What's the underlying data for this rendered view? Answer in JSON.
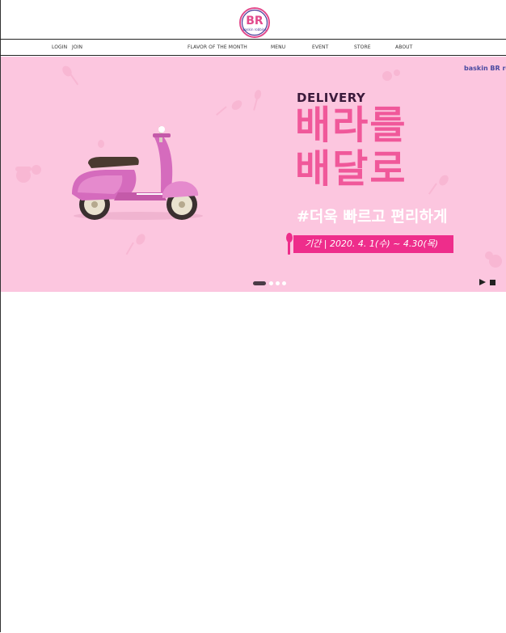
{
  "header": {
    "logo_text": "BR",
    "logo_caption": "baskin robbins"
  },
  "nav": {
    "login": "LOGIN",
    "join": "JOIN",
    "flavor": "FLAVOR OF THE MONTH",
    "menu": "MENU",
    "event": "EVENT",
    "store": "STORE",
    "about": "ABOUT"
  },
  "banner": {
    "brand_mini": "baskin BR ro",
    "label": "DELIVERY",
    "headline_1": "배라를",
    "headline_2": "배달로",
    "subline": "#더욱 빠르고 편리하게",
    "period": "기간 | 2020. 4. 1(수) ~ 4.30(목)",
    "background_color": "#fcc6df",
    "accent_color": "#f0589a",
    "slides": 4,
    "active_slide": 1
  },
  "icons": {
    "play": "play-icon",
    "stop": "stop-icon",
    "scooter": "scooter-illustration"
  }
}
